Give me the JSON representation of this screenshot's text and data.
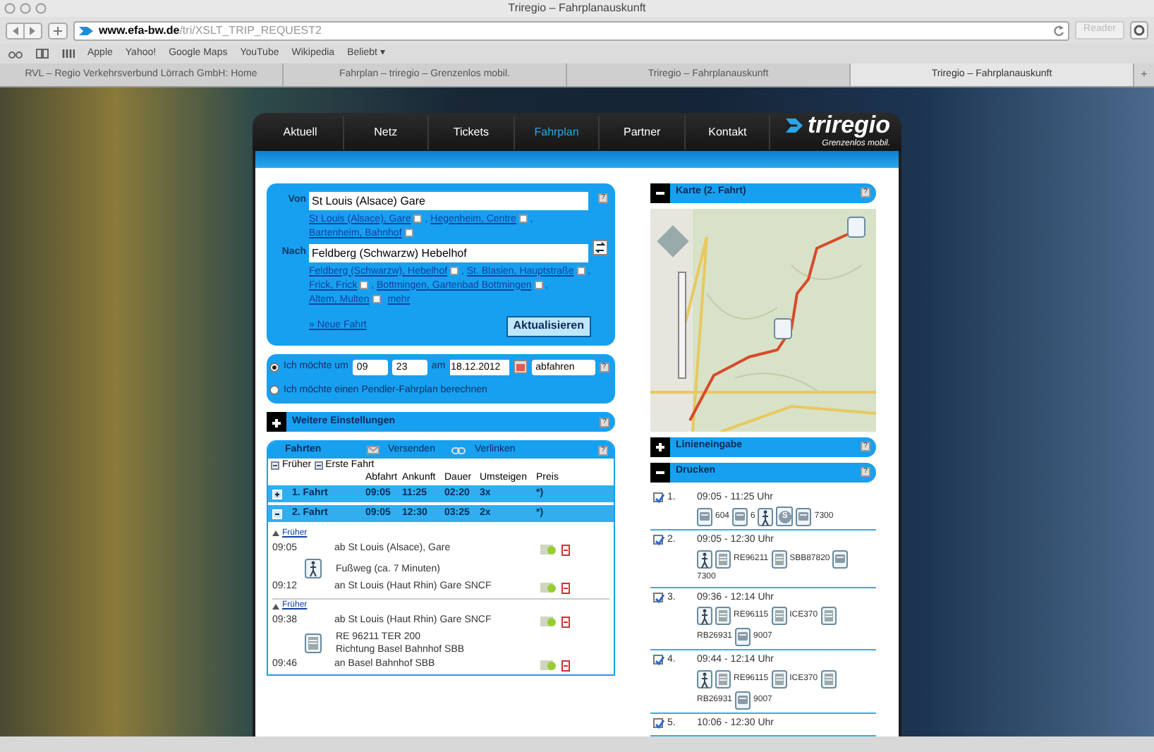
{
  "browser": {
    "title": "Triregio – Fahrplanauskunft",
    "url_host": "www.efa-bw.de",
    "url_path": "/tri/XSLT_TRIP_REQUEST2",
    "reader": "Reader",
    "bookmarks": [
      "Apple",
      "Yahoo!",
      "Google Maps",
      "YouTube",
      "Wikipedia",
      "Beliebt ▾"
    ],
    "tabs": [
      {
        "label": "RVL – Regio Verkehrsverbund Lörrach GmbH: Home",
        "selected": false
      },
      {
        "label": "Fahrplan – triregio – Grenzenlos mobil.",
        "selected": false
      },
      {
        "label": "Triregio – Fahrplanauskunft",
        "selected": false
      },
      {
        "label": "Triregio – Fahrplanauskunft",
        "selected": true
      }
    ],
    "new_tab": "+"
  },
  "nav": {
    "items": [
      {
        "label": "Aktuell",
        "selected": false
      },
      {
        "label": "Netz",
        "selected": false
      },
      {
        "label": "Tickets",
        "selected": false
      },
      {
        "label": "Fahrplan",
        "selected": true
      },
      {
        "label": "Partner",
        "selected": false
      },
      {
        "label": "Kontakt",
        "selected": false
      }
    ],
    "logo": {
      "name": "triregio",
      "tagline": "Grenzenlos mobil."
    }
  },
  "form": {
    "help": "?",
    "separator": ",",
    "from": {
      "label": "Von",
      "value": "St Louis (Alsace) Gare",
      "suggestions": [
        {
          "text": "St Louis (Alsace), Gare",
          "checked": false
        },
        {
          "text": "Hegenheim, Centre",
          "checked": false
        },
        {
          "text": "Bartenheim, Bahnhof",
          "checked": false
        }
      ]
    },
    "to": {
      "label": "Nach",
      "value": "Feldberg (Schwarzw) Hebelhof",
      "suggestions": [
        {
          "text": "Feldberg (Schwarzw), Hebelhof",
          "checked": false
        },
        {
          "text": "St. Blasien, Hauptstraße",
          "checked": false
        },
        {
          "text": "Frick, Frick",
          "checked": false
        },
        {
          "text": "Bottmingen, Gartenbad Bottmingen",
          "checked": false
        },
        {
          "text": "Altem, Multen",
          "checked": false
        }
      ],
      "more": "mehr"
    },
    "new_trip": "» Neue Fahrt",
    "update_button": "Aktualisieren"
  },
  "time": {
    "help": "?",
    "options": [
      {
        "label": "Ich möchte um",
        "selected": true
      },
      {
        "label": "Ich möchte einen Pendler-Fahrplan berechnen",
        "selected": false
      }
    ],
    "hour": "09",
    "minute": "23",
    "date_label": "am",
    "date": "18.12.2012",
    "direction": "abfahren"
  },
  "settings": {
    "title": "Weitere Einstellungen",
    "expanded": false,
    "help": "?"
  },
  "trips": {
    "title": "Fahrten",
    "send": "Versenden",
    "link": "Verlinken",
    "help": "?",
    "earlier": "Früher",
    "first": "Erste Fahrt",
    "columns": [
      "Abfahrt",
      "Ankunft",
      "Dauer",
      "Umsteigen",
      "Preis"
    ],
    "rows": [
      {
        "label": "1. Fahrt",
        "expanded": false,
        "cells": [
          "09:05",
          "11:25",
          "02:20",
          "3x",
          "*)"
        ]
      },
      {
        "label": "2. Fahrt",
        "expanded": true,
        "cells": [
          "09:05",
          "12:30",
          "03:25",
          "2x",
          "*)"
        ]
      }
    ],
    "legs": [
      {
        "kind": "earlier",
        "text": "Früher"
      },
      {
        "kind": "stop",
        "time": "09:05",
        "text": "ab St Louis (Alsace), Gare"
      },
      {
        "kind": "walk",
        "lines": [
          "Fußweg (ca. 7 Minuten)"
        ]
      },
      {
        "kind": "stop",
        "time": "09:12",
        "text": "an St Louis (Haut Rhin) Gare SNCF"
      },
      {
        "kind": "earlier",
        "text": "Früher"
      },
      {
        "kind": "stop",
        "time": "09:38",
        "text": "ab St Louis (Haut Rhin) Gare SNCF"
      },
      {
        "kind": "train",
        "lines": [
          "RE 96211 TER 200",
          "Richtung Basel Bahnhof SBB"
        ]
      },
      {
        "kind": "stop",
        "time": "09:46",
        "text": "an Basel Bahnhof SBB"
      }
    ]
  },
  "map": {
    "title": "Karte (2. Fahrt)",
    "expanded": true,
    "help": "?"
  },
  "lines": {
    "title": "Linieneingabe",
    "expanded": false,
    "help": "?"
  },
  "print": {
    "title": "Drucken",
    "expanded": true,
    "help": "?",
    "items": [
      {
        "number": "1.",
        "checked": true,
        "time": "09:05 - 11:25 Uhr",
        "modes": [
          {
            "kind": "bus",
            "label": "604"
          },
          {
            "kind": "bus",
            "label": "6"
          },
          {
            "kind": "walk"
          },
          {
            "kind": "sbahn",
            "label": "S"
          },
          {
            "kind": "bus",
            "label": "7300"
          }
        ]
      },
      {
        "number": "2.",
        "checked": true,
        "time": "09:05 - 12:30 Uhr",
        "modes": [
          {
            "kind": "walk"
          },
          {
            "kind": "train",
            "label": "RE96211"
          },
          {
            "kind": "train",
            "label": "SBB87820"
          },
          {
            "kind": "bus",
            "label": "7300"
          }
        ]
      },
      {
        "number": "3.",
        "checked": true,
        "time": "09:36 - 12:14 Uhr",
        "modes": [
          {
            "kind": "walk"
          },
          {
            "kind": "train",
            "label": "RE96115"
          },
          {
            "kind": "train",
            "label": "ICE370"
          },
          {
            "kind": "train",
            "label": "RB26931"
          },
          {
            "kind": "bus",
            "label": "9007"
          }
        ]
      },
      {
        "number": "4.",
        "checked": true,
        "time": "09:44 - 12:14 Uhr",
        "modes": [
          {
            "kind": "walk"
          },
          {
            "kind": "train",
            "label": "RE96115"
          },
          {
            "kind": "train",
            "label": "ICE370"
          },
          {
            "kind": "train",
            "label": "RB26931"
          },
          {
            "kind": "bus",
            "label": "9007"
          }
        ]
      },
      {
        "number": "5.",
        "checked": true,
        "time": "10:06 - 12:30 Uhr"
      }
    ]
  }
}
